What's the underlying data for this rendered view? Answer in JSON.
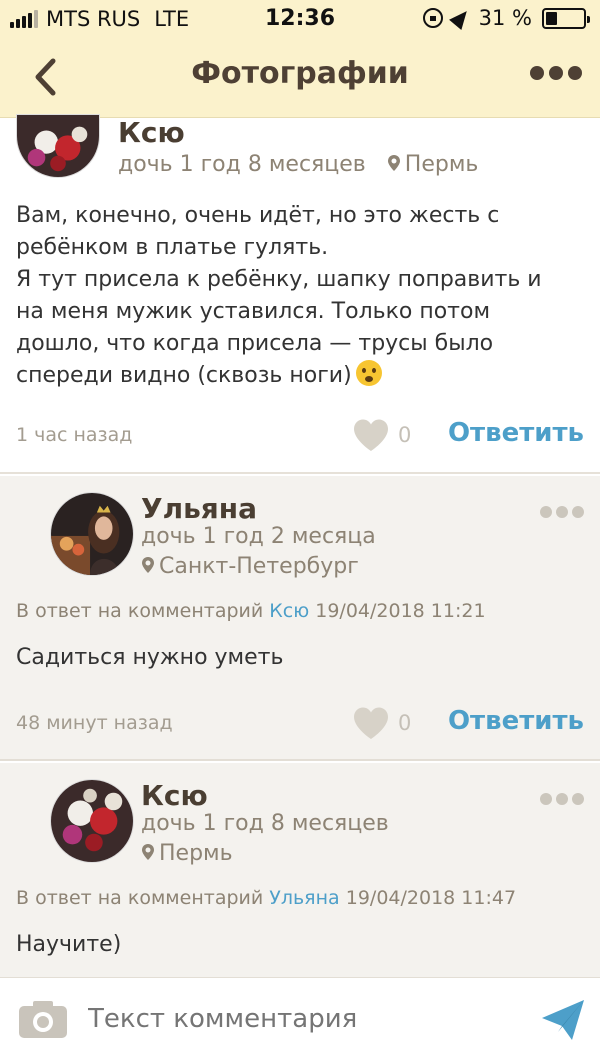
{
  "status_bar": {
    "carrier": "MTS RUS",
    "network": "LTE",
    "time": "12:36",
    "battery": "31 %",
    "battery_level": 0.31
  },
  "nav": {
    "title": "Фотографии",
    "back_icon": "chevron-left-icon",
    "more_icon": "more-dots-icon"
  },
  "comments": [
    {
      "author": "Ксю",
      "child": "дочь 1 год 8 месяцев",
      "location": "Пермь",
      "text_lines": [
        "Вам, конечно, очень идёт, но это жесть с",
        "ребёнком в платье гулять.",
        "Я тут присела к ребёнку, шапку поправить и",
        "на меня мужик уставился. Только потом",
        "дошло, что когда присела — трусы было",
        "спереди видно (сквозь ноги)"
      ],
      "time": "1 час назад",
      "likes": "0",
      "reply_label": "Ответить"
    },
    {
      "author": "Ульяна",
      "child": "дочь 1 год 2 месяца",
      "location": "Санкт-Петербург",
      "reply_prefix": "В ответ на комментарий",
      "reply_to": "Ксю",
      "reply_date": "19/04/2018 11:21",
      "text": "Садиться нужно уметь",
      "time": "48 минут назад",
      "likes": "0",
      "reply_label": "Ответить"
    },
    {
      "author": "Ксю",
      "child": "дочь 1 год 8 месяцев",
      "location": "Пермь",
      "reply_prefix": "В ответ на комментарий",
      "reply_to": "Ульяна",
      "reply_date": "19/04/2018 11:47",
      "text": "Научите)"
    }
  ],
  "composer": {
    "placeholder": "Текст комментария",
    "camera_icon": "camera-icon",
    "send_icon": "send-icon"
  },
  "colors": {
    "header_bg": "#fbf2cc",
    "title": "#4e4034",
    "accent": "#4d9fc9",
    "reply_bg": "#f4f2ee"
  }
}
